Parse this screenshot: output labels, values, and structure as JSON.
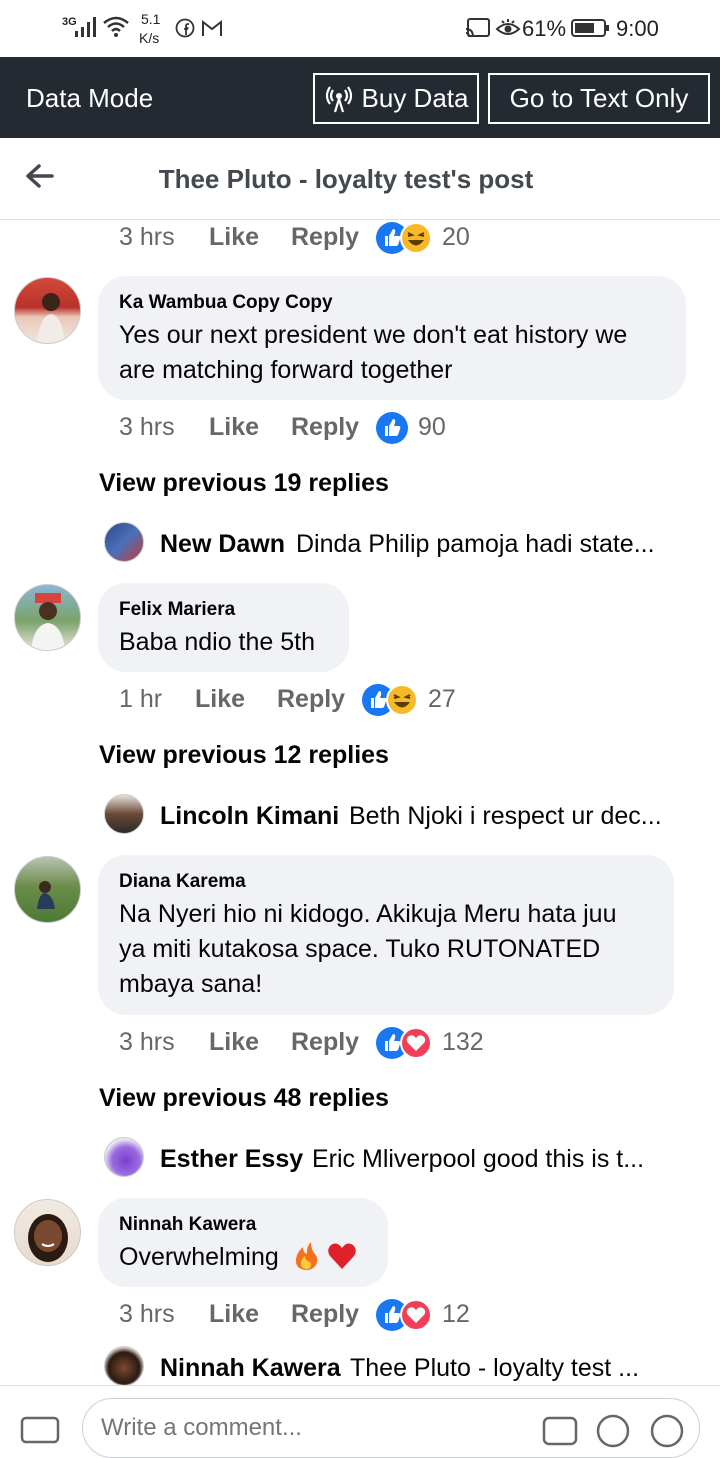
{
  "status_bar": {
    "network": "3G",
    "speed_value": "5.1",
    "speed_unit": "K/s",
    "battery": "61%",
    "time": "9:00"
  },
  "data_bar": {
    "title": "Data Mode",
    "buy_data_label": "Buy Data",
    "text_only_label": "Go to Text Only"
  },
  "nav": {
    "title": "Thee Pluto - loyalty test's post"
  },
  "labels": {
    "like": "Like",
    "reply": "Reply"
  },
  "top_meta": {
    "time": "3 hrs",
    "reactions": [
      "like",
      "haha"
    ],
    "count": "20"
  },
  "comments": [
    {
      "author": "Ka Wambua Copy Copy",
      "text_lines": [
        "Yes our next president we don't eat history we",
        "are matching forward together"
      ],
      "time": "3 hrs",
      "reactions": [
        "like"
      ],
      "count": "90",
      "view_previous": "View previous 19 replies",
      "reply_preview": {
        "name": "New Dawn",
        "text": "Dinda Philip pamoja hadi state..."
      }
    },
    {
      "author": "Felix Mariera",
      "text_lines": [
        "Baba ndio the 5th"
      ],
      "time": "1 hr",
      "reactions": [
        "like",
        "haha"
      ],
      "count": "27",
      "view_previous": "View previous 12 replies",
      "reply_preview": {
        "name": "Lincoln Kimani",
        "text": "Beth Njoki i respect ur dec..."
      }
    },
    {
      "author": "Diana Karema",
      "text_lines": [
        "Na Nyeri hio ni kidogo. Akikuja Meru hata juu",
        "ya miti kutakosa space. Tuko RUTONATED",
        "mbaya sana!"
      ],
      "time": "3 hrs",
      "reactions": [
        "like",
        "love"
      ],
      "count": "132",
      "view_previous": "View previous 48 replies",
      "reply_preview": {
        "name": "Esther Essy",
        "text": "Eric Mliverpool good this is t..."
      }
    },
    {
      "author": "Ninnah Kawera",
      "text": "Overwhelming",
      "emojis": [
        "fire-emoji",
        "red-heart-emoji"
      ],
      "time": "3 hrs",
      "reactions": [
        "like",
        "love"
      ],
      "count": "12",
      "reply_preview": {
        "name": "Ninnah Kawera",
        "text": "Thee Pluto - loyalty test  ..."
      }
    }
  ],
  "composer": {
    "placeholder": "Write a comment..."
  },
  "colors": {
    "data_bar_bg": "#242a31",
    "bubble_bg": "#f0f2f5",
    "like_blue": "#1877f2",
    "love_red": "#f33e58",
    "haha_yellow": "#f7b928",
    "meta_grey": "#65676b"
  }
}
